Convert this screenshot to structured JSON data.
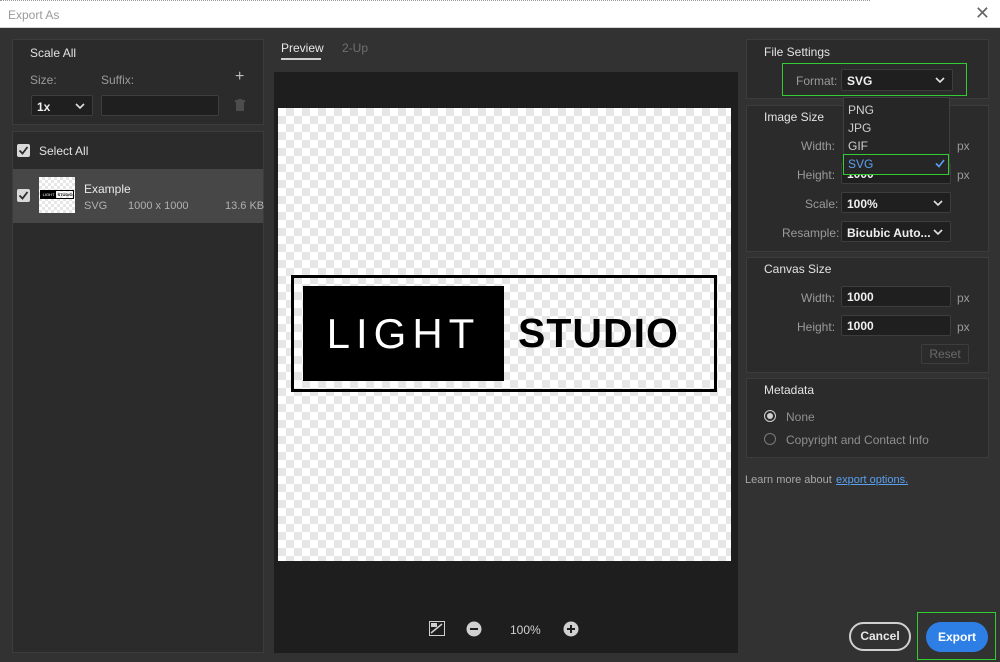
{
  "window": {
    "title": "Export As"
  },
  "tabs": [
    "Preview",
    "2-Up"
  ],
  "left": {
    "scale_all": "Scale All",
    "size_label": "Size:",
    "suffix_label": "Suffix:",
    "size_value": "1x",
    "select_all": "Select All",
    "asset": {
      "name": "Example",
      "type": "SVG",
      "dims": "1000 x 1000",
      "filesize": "13.6 KB",
      "thumb_text_left": "LIGHT",
      "thumb_text_right": "STUDIO"
    }
  },
  "preview": {
    "logo_left": "LIGHT",
    "logo_right": "STUDIO",
    "zoom": "100%"
  },
  "file_settings": {
    "heading": "File Settings",
    "format_label": "Format:",
    "format_value": "SVG",
    "options": [
      "PNG",
      "JPG",
      "GIF",
      "SVG"
    ],
    "selected_option": "SVG"
  },
  "image_size": {
    "heading": "Image Size",
    "width_label": "Width:",
    "height_label": "Height:",
    "height_value": "1000",
    "scale_label": "Scale:",
    "scale_value": "100%",
    "resample_label": "Resample:",
    "resample_value": "Bicubic Auto...",
    "unit": "px"
  },
  "canvas_size": {
    "heading": "Canvas Size",
    "width_label": "Width:",
    "width_value": "1000",
    "height_label": "Height:",
    "height_value": "1000",
    "unit": "px",
    "reset": "Reset"
  },
  "metadata": {
    "heading": "Metadata",
    "options": [
      "None",
      "Copyright and Contact Info"
    ],
    "selected": "None"
  },
  "learn_more": {
    "text": "Learn more about",
    "link": "export options."
  },
  "buttons": {
    "cancel": "Cancel",
    "export": "Export"
  },
  "colors": {
    "accent": "#2d7fe6",
    "highlight": "#33cc33",
    "dialog_bg": "#323232"
  }
}
